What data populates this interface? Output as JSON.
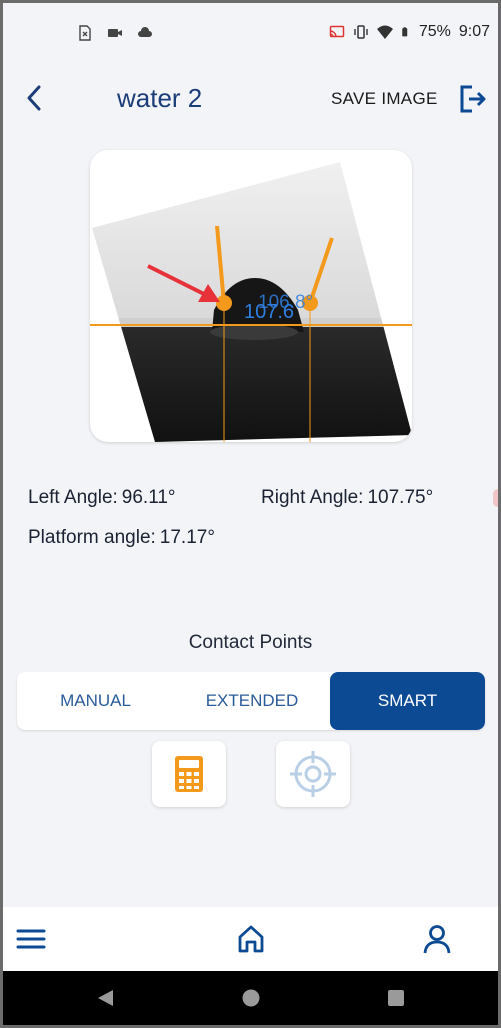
{
  "status_bar": {
    "battery": "75%",
    "time": "9:07",
    "left_icons": [
      "sim-card-icon",
      "video-camera-icon",
      "cloud-icon"
    ],
    "right_icons": [
      "cast-icon",
      "vibrate-icon",
      "wifi-icon",
      "battery-icon"
    ]
  },
  "header": {
    "title": "water 2",
    "save_label": "SAVE IMAGE",
    "back_icon": "back-arrow-icon",
    "exit_icon": "exit-icon"
  },
  "measurement_image": {
    "overlay_text_back": "106.8°",
    "overlay_text_front": "107.6"
  },
  "readouts": {
    "left_angle_label": "Left Angle:",
    "left_angle_value": "96.11°",
    "right_angle_label": "Right Angle:",
    "right_angle_value": "107.75°",
    "platform_angle_label": "Platform angle:",
    "platform_angle_value": "17.17°"
  },
  "contact_points": {
    "label": "Contact Points",
    "modes": [
      "MANUAL",
      "EXTENDED",
      "SMART"
    ],
    "selected": "SMART"
  },
  "tools": [
    "calculator-icon",
    "crosshair-icon"
  ],
  "colors": {
    "primary_blue": "#0d4a94",
    "title_blue": "#1b3d78",
    "accent_orange": "#f39a1c",
    "overlay_blue": "#2f7fe0",
    "arrow_red": "#e8323a"
  },
  "bottom_nav": [
    "menu-icon",
    "home-icon",
    "profile-icon"
  ],
  "system_nav": [
    "system-back-icon",
    "system-home-icon",
    "system-recents-icon"
  ]
}
